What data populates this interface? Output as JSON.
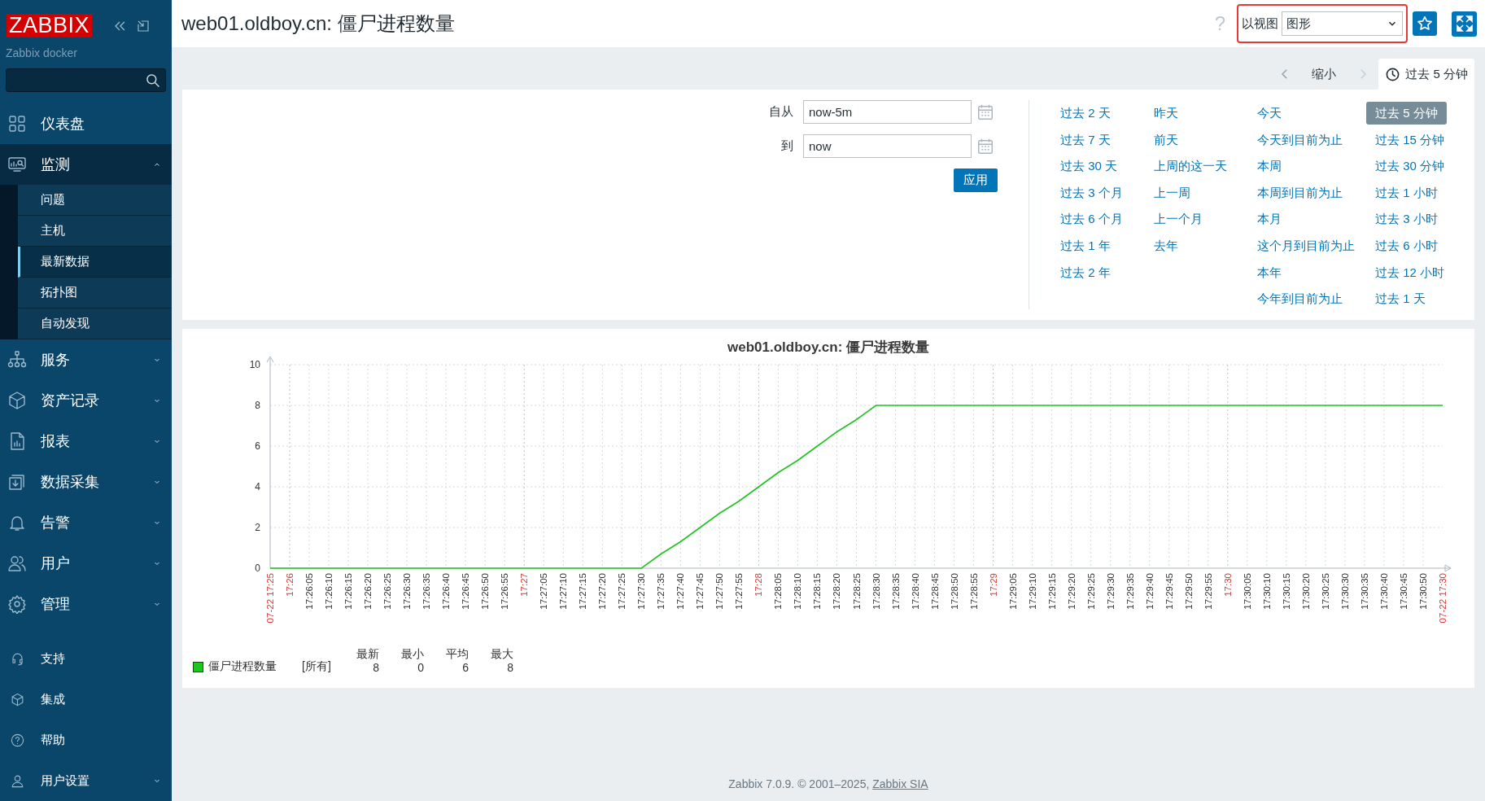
{
  "sidebar": {
    "logo": "ZABBIX",
    "server_name": "Zabbix docker",
    "menu": [
      {
        "label": "仪表盘",
        "kind": "link"
      },
      {
        "label": "监测",
        "kind": "group",
        "expanded": true,
        "children": [
          {
            "label": "问题",
            "selected": false
          },
          {
            "label": "主机",
            "selected": false
          },
          {
            "label": "最新数据",
            "selected": true
          },
          {
            "label": "拓扑图",
            "selected": false
          },
          {
            "label": "自动发现",
            "selected": false
          }
        ]
      },
      {
        "label": "服务",
        "kind": "group",
        "expanded": false
      },
      {
        "label": "资产记录",
        "kind": "group",
        "expanded": false
      },
      {
        "label": "报表",
        "kind": "group",
        "expanded": false
      },
      {
        "label": "数据采集",
        "kind": "group",
        "expanded": false
      },
      {
        "label": "告警",
        "kind": "group",
        "expanded": false
      },
      {
        "label": "用户",
        "kind": "group",
        "expanded": false
      },
      {
        "label": "管理",
        "kind": "group",
        "expanded": false
      }
    ],
    "bottom_menu": [
      {
        "label": "支持",
        "kind": "link"
      },
      {
        "label": "集成",
        "kind": "link"
      },
      {
        "label": "帮助",
        "kind": "link"
      },
      {
        "label": "用户设置",
        "kind": "group",
        "expanded": false
      }
    ]
  },
  "header": {
    "title": "web01.oldboy.cn: 僵尸进程数量",
    "help": "?",
    "view_as": {
      "label": "以视图",
      "value": "图形"
    }
  },
  "timebar": {
    "zoom_out": "缩小",
    "tab": {
      "label": "过去 5 分钟",
      "selected": true
    }
  },
  "filter": {
    "from": {
      "label": "自从",
      "value": "now-5m"
    },
    "to": {
      "label": "到",
      "value": "now"
    },
    "apply": "应用",
    "presets": [
      [
        {
          "label": "过去 2 天",
          "selected": false
        },
        {
          "label": "过去 7 天",
          "selected": false
        },
        {
          "label": "过去 30 天",
          "selected": false
        },
        {
          "label": "过去 3 个月",
          "selected": false
        },
        {
          "label": "过去 6 个月",
          "selected": false
        },
        {
          "label": "过去 1 年",
          "selected": false
        },
        {
          "label": "过去 2 年",
          "selected": false
        }
      ],
      [
        {
          "label": "昨天",
          "selected": false
        },
        {
          "label": "前天",
          "selected": false
        },
        {
          "label": "上周的这一天",
          "selected": false
        },
        {
          "label": "上一周",
          "selected": false
        },
        {
          "label": "上一个月",
          "selected": false
        },
        {
          "label": "去年",
          "selected": false
        }
      ],
      [
        {
          "label": "今天",
          "selected": false
        },
        {
          "label": "今天到目前为止",
          "selected": false
        },
        {
          "label": "本周",
          "selected": false
        },
        {
          "label": "本周到目前为止",
          "selected": false
        },
        {
          "label": "本月",
          "selected": false
        },
        {
          "label": "这个月到目前为止",
          "selected": false
        },
        {
          "label": "本年",
          "selected": false
        },
        {
          "label": "今年到目前为止",
          "selected": false
        }
      ],
      [
        {
          "label": "过去 5 分钟",
          "selected": true
        },
        {
          "label": "过去 15 分钟",
          "selected": false
        },
        {
          "label": "过去 30 分钟",
          "selected": false
        },
        {
          "label": "过去 1 小时",
          "selected": false
        },
        {
          "label": "过去 3 小时",
          "selected": false
        },
        {
          "label": "过去 6 小时",
          "selected": false
        },
        {
          "label": "过去 12 小时",
          "selected": false
        },
        {
          "label": "过去 1 天",
          "selected": false
        }
      ]
    ]
  },
  "graph": {
    "chart_data": {
      "type": "line",
      "title": "web01.oldboy.cn: 僵尸进程数量",
      "categories": [
        "07-22 17:25",
        "17:26",
        "17:26:05",
        "17:26:10",
        "17:26:15",
        "17:26:20",
        "17:26:25",
        "17:26:30",
        "17:26:35",
        "17:26:40",
        "17:26:45",
        "17:26:50",
        "17:26:55",
        "17:27",
        "17:27:05",
        "17:27:10",
        "17:27:15",
        "17:27:20",
        "17:27:25",
        "17:27:30",
        "17:27:35",
        "17:27:40",
        "17:27:45",
        "17:27:50",
        "17:27:55",
        "17:28",
        "17:28:05",
        "17:28:10",
        "17:28:15",
        "17:28:20",
        "17:28:25",
        "17:28:30",
        "17:28:35",
        "17:28:40",
        "17:28:45",
        "17:28:50",
        "17:28:55",
        "17:29",
        "17:29:05",
        "17:29:10",
        "17:29:15",
        "17:29:20",
        "17:29:25",
        "17:29:30",
        "17:29:35",
        "17:29:40",
        "17:29:45",
        "17:29:50",
        "17:29:55",
        "17:30",
        "17:30:05",
        "17:30:10",
        "17:30:15",
        "17:30:20",
        "17:30:25",
        "17:30:30",
        "17:30:35",
        "17:30:40",
        "17:30:45",
        "17:30:50",
        "07-22 17:30"
      ],
      "series": [
        {
          "name": "僵尸进程数量",
          "color": "#1fc41f",
          "values": [
            0,
            0,
            0,
            0,
            0,
            0,
            0,
            0,
            0,
            0,
            0,
            0,
            0,
            0,
            0,
            0,
            0,
            0,
            0,
            0,
            0.7,
            1.3,
            2,
            2.7,
            3.3,
            4,
            4.7,
            5.3,
            6,
            6.7,
            7.3,
            8,
            8,
            8,
            8,
            8,
            8,
            8,
            8,
            8,
            8,
            8,
            8,
            8,
            8,
            8,
            8,
            8,
            8,
            8,
            8,
            8,
            8,
            8,
            8,
            8,
            8,
            8,
            8,
            8,
            8
          ]
        }
      ],
      "ylim": [
        0,
        10
      ],
      "yticks": [
        0,
        2,
        4,
        6,
        8,
        10
      ],
      "grid": true
    },
    "x_label_highlighted": [
      true,
      true,
      false,
      false,
      false,
      false,
      false,
      false,
      false,
      false,
      false,
      false,
      false,
      true,
      false,
      false,
      false,
      false,
      false,
      false,
      false,
      false,
      false,
      false,
      false,
      true,
      false,
      false,
      false,
      false,
      false,
      false,
      false,
      false,
      false,
      false,
      false,
      true,
      false,
      false,
      false,
      false,
      false,
      false,
      false,
      false,
      false,
      false,
      false,
      true,
      false,
      false,
      false,
      false,
      false,
      false,
      false,
      false,
      false,
      false,
      true
    ],
    "legend": {
      "function": "[所有]",
      "stats": [
        {
          "label": "最新",
          "value": "8"
        },
        {
          "label": "最小",
          "value": "0"
        },
        {
          "label": "平均",
          "value": "6"
        },
        {
          "label": "最大",
          "value": "8"
        }
      ]
    }
  },
  "footer": {
    "text": "Zabbix 7.0.9. © 2001–2025, ",
    "link": "Zabbix SIA"
  }
}
